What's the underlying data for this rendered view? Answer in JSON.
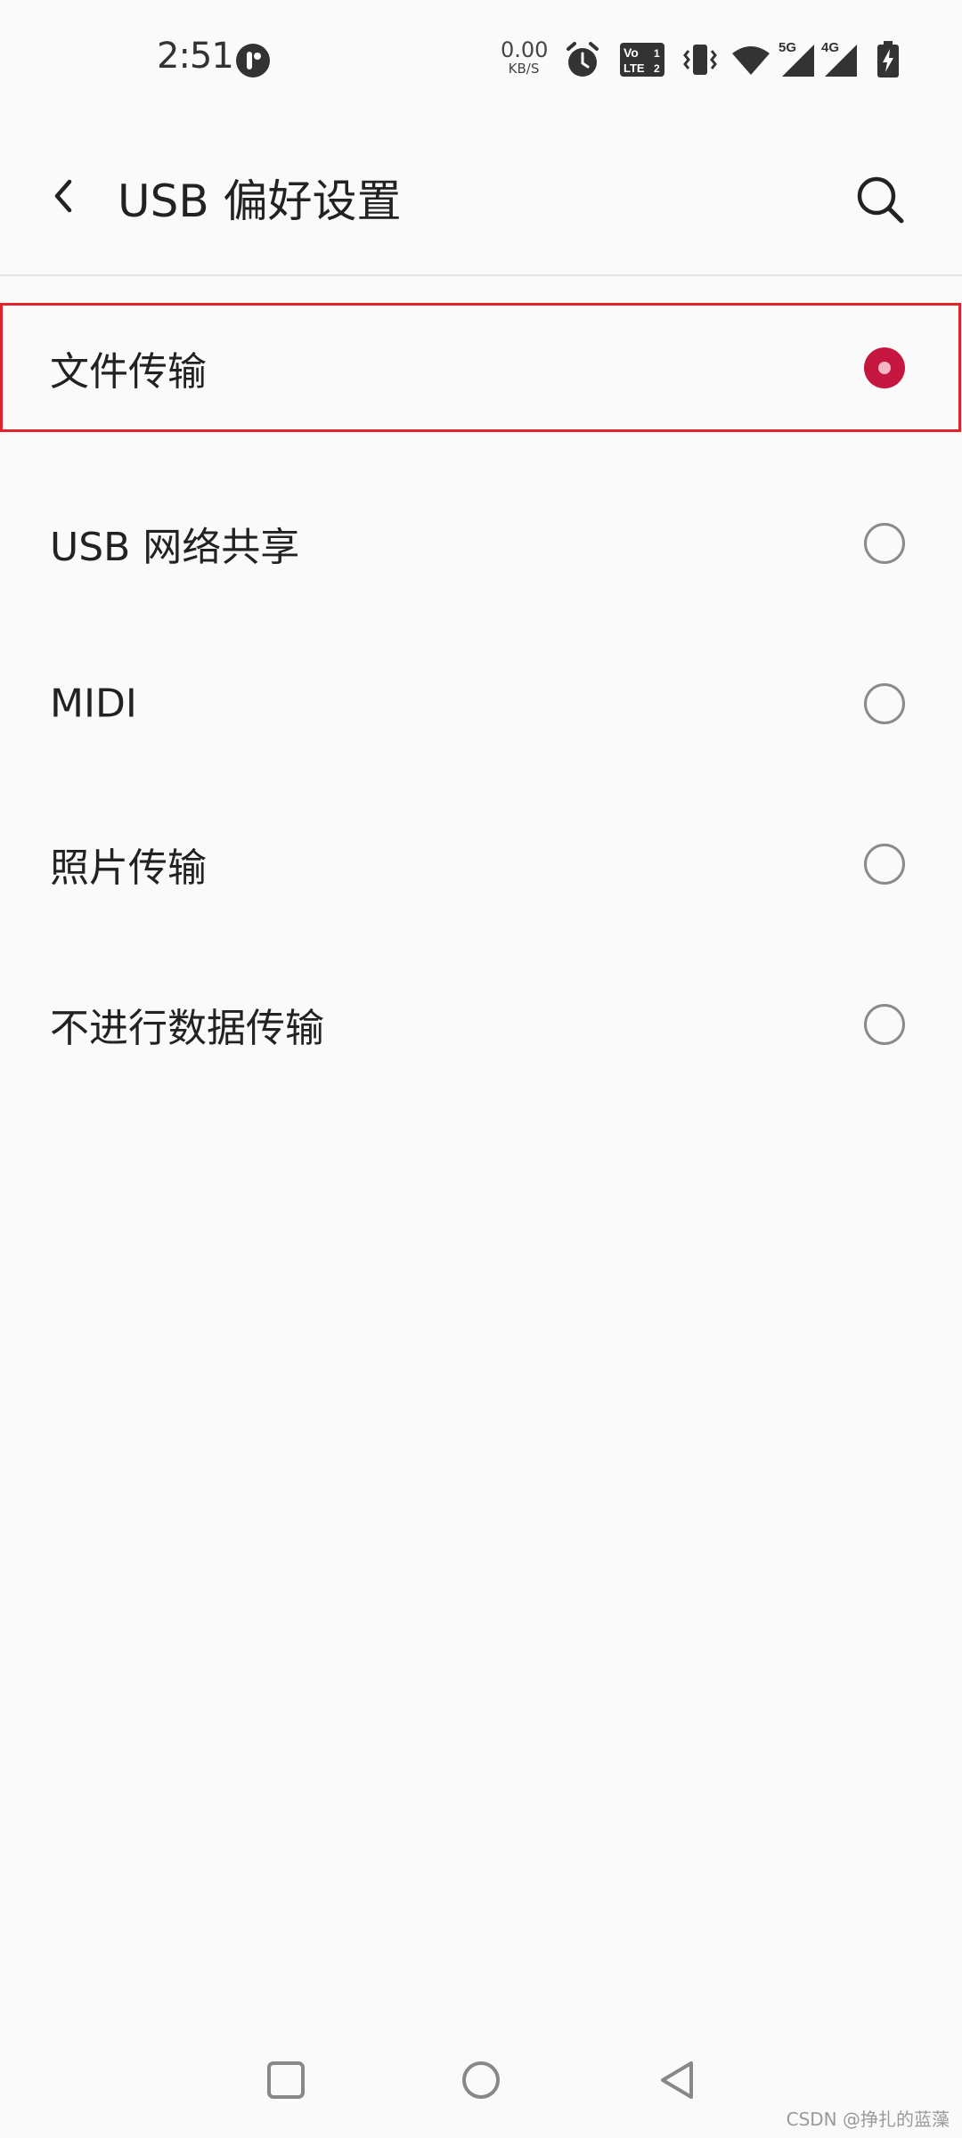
{
  "status_bar": {
    "time": "2:51",
    "net_speed_value": "0.00",
    "net_speed_unit": "KB/S",
    "icons": [
      "app-notification-icon",
      "alarm-icon",
      "volte-icon",
      "vibrate-icon",
      "wifi-icon",
      "signal-5g-icon",
      "signal-4g-icon",
      "battery-charging-icon"
    ],
    "signal_5g_label": "5G",
    "signal_4g_label": "4G",
    "volte_top": "Vo",
    "volte_bottom": "LTE"
  },
  "app_bar": {
    "title": "USB 偏好设置",
    "back_icon": "back-arrow-icon",
    "search_icon": "search-icon"
  },
  "options": [
    {
      "label": "文件传输",
      "selected": true
    },
    {
      "label": "USB 网络共享",
      "selected": false
    },
    {
      "label": "MIDI",
      "selected": false
    },
    {
      "label": "照片传输",
      "selected": false
    },
    {
      "label": "不进行数据传输",
      "selected": false
    }
  ],
  "nav_bar": {
    "icons": [
      "recents-icon",
      "home-icon",
      "back-icon"
    ]
  },
  "watermark": "CSDN @挣扎的蓝藻",
  "colors": {
    "accent": "#c4163e",
    "highlight_border": "#e2232a",
    "background": "#fafafa"
  }
}
